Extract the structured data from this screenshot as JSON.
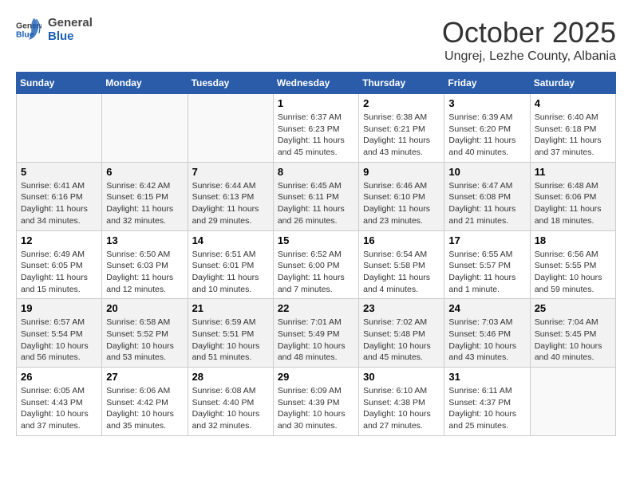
{
  "header": {
    "logo_general": "General",
    "logo_blue": "Blue",
    "month": "October 2025",
    "location": "Ungrej, Lezhe County, Albania"
  },
  "weekdays": [
    "Sunday",
    "Monday",
    "Tuesday",
    "Wednesday",
    "Thursday",
    "Friday",
    "Saturday"
  ],
  "weeks": [
    [
      {
        "day": "",
        "info": ""
      },
      {
        "day": "",
        "info": ""
      },
      {
        "day": "",
        "info": ""
      },
      {
        "day": "1",
        "info": "Sunrise: 6:37 AM\nSunset: 6:23 PM\nDaylight: 11 hours\nand 45 minutes."
      },
      {
        "day": "2",
        "info": "Sunrise: 6:38 AM\nSunset: 6:21 PM\nDaylight: 11 hours\nand 43 minutes."
      },
      {
        "day": "3",
        "info": "Sunrise: 6:39 AM\nSunset: 6:20 PM\nDaylight: 11 hours\nand 40 minutes."
      },
      {
        "day": "4",
        "info": "Sunrise: 6:40 AM\nSunset: 6:18 PM\nDaylight: 11 hours\nand 37 minutes."
      }
    ],
    [
      {
        "day": "5",
        "info": "Sunrise: 6:41 AM\nSunset: 6:16 PM\nDaylight: 11 hours\nand 34 minutes."
      },
      {
        "day": "6",
        "info": "Sunrise: 6:42 AM\nSunset: 6:15 PM\nDaylight: 11 hours\nand 32 minutes."
      },
      {
        "day": "7",
        "info": "Sunrise: 6:44 AM\nSunset: 6:13 PM\nDaylight: 11 hours\nand 29 minutes."
      },
      {
        "day": "8",
        "info": "Sunrise: 6:45 AM\nSunset: 6:11 PM\nDaylight: 11 hours\nand 26 minutes."
      },
      {
        "day": "9",
        "info": "Sunrise: 6:46 AM\nSunset: 6:10 PM\nDaylight: 11 hours\nand 23 minutes."
      },
      {
        "day": "10",
        "info": "Sunrise: 6:47 AM\nSunset: 6:08 PM\nDaylight: 11 hours\nand 21 minutes."
      },
      {
        "day": "11",
        "info": "Sunrise: 6:48 AM\nSunset: 6:06 PM\nDaylight: 11 hours\nand 18 minutes."
      }
    ],
    [
      {
        "day": "12",
        "info": "Sunrise: 6:49 AM\nSunset: 6:05 PM\nDaylight: 11 hours\nand 15 minutes."
      },
      {
        "day": "13",
        "info": "Sunrise: 6:50 AM\nSunset: 6:03 PM\nDaylight: 11 hours\nand 12 minutes."
      },
      {
        "day": "14",
        "info": "Sunrise: 6:51 AM\nSunset: 6:01 PM\nDaylight: 11 hours\nand 10 minutes."
      },
      {
        "day": "15",
        "info": "Sunrise: 6:52 AM\nSunset: 6:00 PM\nDaylight: 11 hours\nand 7 minutes."
      },
      {
        "day": "16",
        "info": "Sunrise: 6:54 AM\nSunset: 5:58 PM\nDaylight: 11 hours\nand 4 minutes."
      },
      {
        "day": "17",
        "info": "Sunrise: 6:55 AM\nSunset: 5:57 PM\nDaylight: 11 hours\nand 1 minute."
      },
      {
        "day": "18",
        "info": "Sunrise: 6:56 AM\nSunset: 5:55 PM\nDaylight: 10 hours\nand 59 minutes."
      }
    ],
    [
      {
        "day": "19",
        "info": "Sunrise: 6:57 AM\nSunset: 5:54 PM\nDaylight: 10 hours\nand 56 minutes."
      },
      {
        "day": "20",
        "info": "Sunrise: 6:58 AM\nSunset: 5:52 PM\nDaylight: 10 hours\nand 53 minutes."
      },
      {
        "day": "21",
        "info": "Sunrise: 6:59 AM\nSunset: 5:51 PM\nDaylight: 10 hours\nand 51 minutes."
      },
      {
        "day": "22",
        "info": "Sunrise: 7:01 AM\nSunset: 5:49 PM\nDaylight: 10 hours\nand 48 minutes."
      },
      {
        "day": "23",
        "info": "Sunrise: 7:02 AM\nSunset: 5:48 PM\nDaylight: 10 hours\nand 45 minutes."
      },
      {
        "day": "24",
        "info": "Sunrise: 7:03 AM\nSunset: 5:46 PM\nDaylight: 10 hours\nand 43 minutes."
      },
      {
        "day": "25",
        "info": "Sunrise: 7:04 AM\nSunset: 5:45 PM\nDaylight: 10 hours\nand 40 minutes."
      }
    ],
    [
      {
        "day": "26",
        "info": "Sunrise: 6:05 AM\nSunset: 4:43 PM\nDaylight: 10 hours\nand 37 minutes."
      },
      {
        "day": "27",
        "info": "Sunrise: 6:06 AM\nSunset: 4:42 PM\nDaylight: 10 hours\nand 35 minutes."
      },
      {
        "day": "28",
        "info": "Sunrise: 6:08 AM\nSunset: 4:40 PM\nDaylight: 10 hours\nand 32 minutes."
      },
      {
        "day": "29",
        "info": "Sunrise: 6:09 AM\nSunset: 4:39 PM\nDaylight: 10 hours\nand 30 minutes."
      },
      {
        "day": "30",
        "info": "Sunrise: 6:10 AM\nSunset: 4:38 PM\nDaylight: 10 hours\nand 27 minutes."
      },
      {
        "day": "31",
        "info": "Sunrise: 6:11 AM\nSunset: 4:37 PM\nDaylight: 10 hours\nand 25 minutes."
      },
      {
        "day": "",
        "info": ""
      }
    ]
  ]
}
